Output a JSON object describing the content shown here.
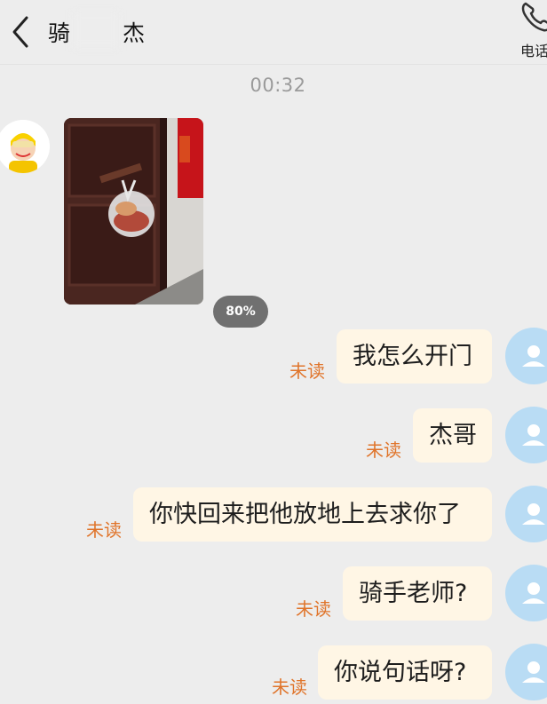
{
  "header": {
    "title_left": "骑",
    "title_right": "杰",
    "phone_label": "电话"
  },
  "chat": {
    "timestamp": "00:32",
    "image_upload_progress": "80%",
    "unread_label": "未读",
    "messages": [
      {
        "text": "我怎么开门",
        "status": "未读"
      },
      {
        "text": "杰哥",
        "status": "未读"
      },
      {
        "text": "你快回来把他放地上去求你了",
        "status": "未读"
      },
      {
        "text": "骑手老师?",
        "status": "未读"
      },
      {
        "text": "你说句话呀?",
        "status": "未读"
      }
    ]
  },
  "colors": {
    "bubble_bg": "#fff6e5",
    "unread_text": "#e0742a",
    "avatar_placeholder": "#b9dcf4",
    "background": "#ededed"
  },
  "icons": [
    "back-arrow-icon",
    "phone-icon",
    "user-placeholder-icon"
  ]
}
